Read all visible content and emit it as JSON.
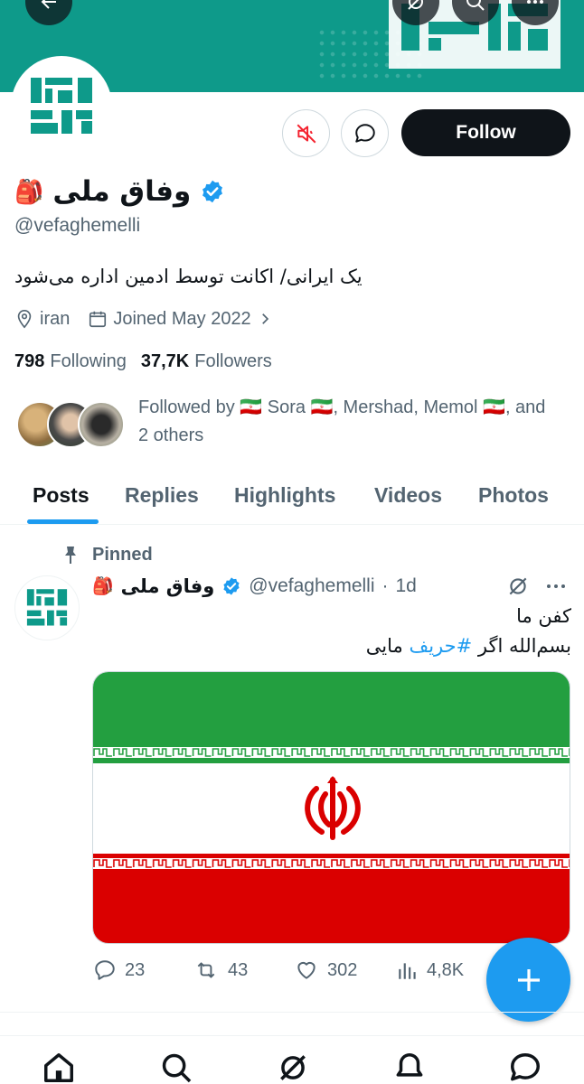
{
  "profile": {
    "display_name": "وفاق ملی",
    "name_emoji": "🎒",
    "handle": "@vefaghemelli",
    "bio": "یک ایرانی/ اکانت توسط ادمین اداره می‌شود",
    "location": "iran",
    "joined": "Joined May 2022",
    "following_count": "798",
    "following_label": "Following",
    "followers_count": "37,7K",
    "followers_label": "Followers",
    "followed_by_line1": "Followed by 🇮🇷 Sora 🇮🇷, Mershad, Memol 🇮🇷, and",
    "followed_by_line2": "2 others",
    "logo_text": "وفاق ملی"
  },
  "actions": {
    "follow_label": "Follow"
  },
  "tabs": [
    {
      "label": "Posts",
      "active": true
    },
    {
      "label": "Replies",
      "active": false
    },
    {
      "label": "Highlights",
      "active": false
    },
    {
      "label": "Videos",
      "active": false
    },
    {
      "label": "Photos",
      "active": false
    }
  ],
  "post": {
    "pinned_label": "Pinned",
    "author_name": "وفاق ملی",
    "author_emoji": "🎒",
    "author_handle": "@vefaghemelli",
    "separator": "·",
    "time": "1d",
    "line1": "کفن ما",
    "line2_prefix": "بسم‌الله اگر ",
    "hashtag": "#حریف",
    "line2_suffix": " مایی",
    "replies": "23",
    "reposts": "43",
    "likes": "302",
    "views": "4,8K"
  },
  "colors": {
    "brand_teal": "#0e9a8a",
    "accent_blue": "#1d9bf0",
    "mute_red": "#f4212e",
    "flag_green": "#239f40",
    "flag_red": "#da0000"
  },
  "icons": [
    "back-arrow-icon",
    "grok-icon",
    "search-icon",
    "more-icon",
    "mute-icon",
    "message-icon",
    "verified-badge-icon",
    "location-icon",
    "calendar-icon",
    "chevron-right-icon",
    "pin-icon",
    "reply-icon",
    "repost-icon",
    "like-icon",
    "views-icon",
    "compose-plus-icon",
    "home-icon",
    "notifications-icon"
  ]
}
